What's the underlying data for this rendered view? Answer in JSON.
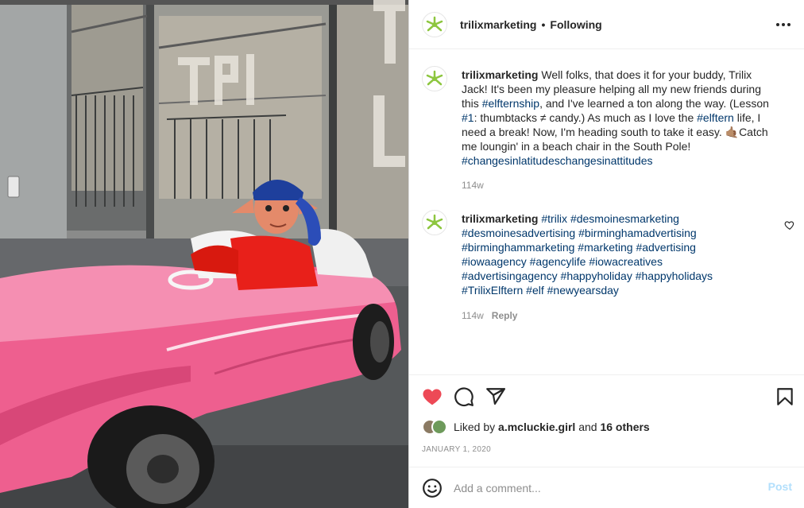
{
  "header": {
    "username": "trilixmarketing",
    "separator": "•",
    "follow_status": "Following",
    "more_icon": "more-horizontal-icon"
  },
  "caption": {
    "username": "trilixmarketing",
    "text_1": " Well folks, that does it for your buddy, Trilix Jack! It's been my pleasure helping all my new friends during this ",
    "tag_1": "#elfternship",
    "text_2": ", and I've learned a ton along the way. (Lesson ",
    "tag_2": "#1",
    "text_3": ": thumbtacks ≠ candy.) As much as I love the ",
    "tag_3": "#elftern",
    "text_4": " life, I need a break! Now, I'm heading south to take it easy. ",
    "emoji": "🤙🏽",
    "text_5": "Catch me loungin' in a beach chair in the South Pole! ",
    "tag_4": "#changesinlatitudeschangesinattitudes",
    "time": "114w"
  },
  "comment": {
    "username": "trilixmarketing",
    "tags": [
      "#trilix",
      "#desmoinesmarketing",
      "#desmoinesadvertising",
      "#birminghamadvertising",
      "#birminghammarketing",
      "#marketing",
      "#advertising",
      "#iowaagency",
      "#agencylife",
      "#iowacreatives",
      "#advertisingagency",
      "#happyholiday",
      "#happyholidays",
      "#TrilixElftern",
      "#elf",
      "#newyearsday"
    ],
    "time": "114w",
    "reply_label": "Reply"
  },
  "actions": {
    "icons": [
      "heart-filled-icon",
      "comment-icon",
      "share-icon",
      "bookmark-icon"
    ],
    "liked_by_prefix": "Liked by ",
    "liked_by_user": "a.mcluckie.girl",
    "liked_by_mid": " and ",
    "liked_by_others": "16 others",
    "date": "JANUARY 1, 2020"
  },
  "add_comment": {
    "placeholder": "Add a comment...",
    "post_label": "Post"
  },
  "colors": {
    "like_red": "#ed4956",
    "hashtag_blue": "#00376b",
    "brand_green": "#8dc63f",
    "post_disabled": "#b2dffc"
  }
}
